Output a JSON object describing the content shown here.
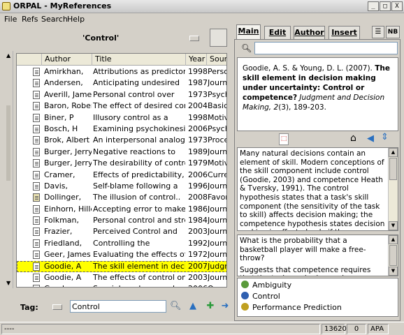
{
  "window": {
    "title": "ORPAL - MyReferences",
    "buttons": [
      "_",
      "□",
      "X"
    ]
  },
  "menu": [
    "File",
    "Refs",
    "Search",
    "Help"
  ],
  "filter": {
    "title": "'Control'"
  },
  "table": {
    "columns": [
      "Author",
      "Title",
      "Year",
      "Source"
    ],
    "rows": [
      {
        "author": "Amirkhan,",
        "title": "Attributions as predictors of",
        "year": "1998",
        "source": "Perso",
        "icon": "document"
      },
      {
        "author": "Andersen,",
        "title": "Anticipating undesired",
        "year": "1987",
        "source": "Journa",
        "icon": "document"
      },
      {
        "author": "Averill, James",
        "title": "Personal control over",
        "year": "1973",
        "source": "Psych",
        "icon": "document"
      },
      {
        "author": "Baron, Robert",
        "title": "The effect of desired contro",
        "year": "2004",
        "source": "Basic",
        "icon": "document"
      },
      {
        "author": "Biner, P",
        "title": "Illusory control as a",
        "year": "1998",
        "source": "Motiva",
        "icon": "document"
      },
      {
        "author": "Bosch, H",
        "title": "Examining psychokinesis:",
        "year": "2006",
        "source": "Psych",
        "icon": "document"
      },
      {
        "author": "Brok, Albert",
        "title": "An interpersonal analogue",
        "year": "1973",
        "source": "Proce",
        "icon": "document"
      },
      {
        "author": "Burger, Jerry",
        "title": "Negative reactions to",
        "year": "1989",
        "source": "Journa",
        "icon": "document"
      },
      {
        "author": "Burger, Jerry",
        "title": "The desirability of control.",
        "year": "1979",
        "source": "Motiva",
        "icon": "document"
      },
      {
        "author": "Cramer,",
        "title": "Effects of predictability,",
        "year": "2006",
        "source": "Curre",
        "icon": "document"
      },
      {
        "author": "Davis,",
        "title": "Self-blame following a",
        "year": "1996",
        "source": "Journa",
        "icon": "document"
      },
      {
        "author": "Dollinger,",
        "title": "The illusion of control..",
        "year": "2008",
        "source": "Favor",
        "icon": "book"
      },
      {
        "author": "Einhorn, Hillel",
        "title": "Accepting error to make",
        "year": "1986",
        "source": "Journa",
        "icon": "document"
      },
      {
        "author": "Folkman,",
        "title": "Personal control and stress",
        "year": "1984",
        "source": "Journa",
        "icon": "document"
      },
      {
        "author": "Frazier,",
        "title": "Perceived Control and",
        "year": "2003",
        "source": "Journa",
        "icon": "document"
      },
      {
        "author": "Friedland,",
        "title": "Controlling the",
        "year": "1992",
        "source": "Journa",
        "icon": "document"
      },
      {
        "author": "Geer, James",
        "title": "Evaluating the effects of the",
        "year": "1972",
        "source": "Journa",
        "icon": "document"
      },
      {
        "author": "Goodie, A",
        "title": "The skill element in decision",
        "year": "2007",
        "source": "Judgm",
        "icon": "document",
        "selected": true
      },
      {
        "author": "Goodie, A",
        "title": "The effects of control on",
        "year": "2003",
        "source": "Journa",
        "icon": "document"
      },
      {
        "author": "Goodman,",
        "title": "Special random numbers:",
        "year": "2006",
        "source": "Organ",
        "icon": "document"
      }
    ]
  },
  "tagbar": {
    "label": "Tag:",
    "value": "Control"
  },
  "tabs": [
    "Main",
    "Edit",
    "Author",
    "Insert"
  ],
  "tab_icons": [
    "list-view-icon",
    "NB"
  ],
  "citation": {
    "authors": "Goodie, A. S. & Young, D. L. (2007).",
    "title": "The skill element in decision making under uncertainty: Control or competence?",
    "journal": "Judgment and Decision Making,",
    "volume": "2",
    "rest": "(3), 189-203."
  },
  "abstract": "Many natural decisions contain an element of skill. Modern conceptions of the skill component include control (Goodie, 2003) and competence Heath & Tversky, 1991). The control hypothesis states that a task's skill component (the sensitivity of the task to skill) affects decision making; the competence hypothesis states decision making is affected only if the participant possesses the skill. Three experiments compared risk taking patterns between two",
  "notes": {
    "q": "What is the probability that a basketball player will make a free-throw?",
    "a": "Suggests that competence requires that the task can be learned."
  },
  "tags": [
    {
      "name": "Ambiguity",
      "color": "#5a9a3a"
    },
    {
      "name": "Control",
      "color": "#3060b0"
    },
    {
      "name": "Performance Prediction",
      "color": "#c0a020"
    }
  ],
  "status": {
    "left": "----",
    "count": "13620",
    "zero": "0",
    "style": "APA"
  },
  "colors": {
    "selected_row": "#ffff00",
    "chrome": "#d4d0c8"
  }
}
